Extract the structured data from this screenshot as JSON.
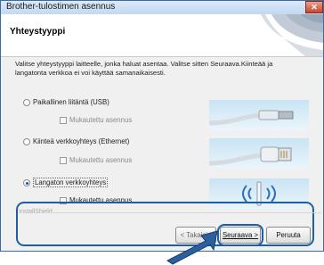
{
  "window": {
    "title": "Brother-tulostimen asennus",
    "close_symbol": "✕"
  },
  "header": {
    "heading": "Yhteystyyppi"
  },
  "description": "Valitse yhteystyyppi laitteelle, jonka haluat asentaa. Valitse sitten Seuraava.Kiinteää ja langatonta verkkoa ei voi käyttää samanaikaisesti.",
  "options": [
    {
      "label": "Paikallinen liitäntä (USB)",
      "selected": false,
      "custom_label": "Mukautettu asennus",
      "custom_enabled": false
    },
    {
      "label": "Kiinteä verkkoyhteys (Ethernet)",
      "selected": false,
      "custom_label": "Mukautettu asennus",
      "custom_enabled": false
    },
    {
      "label": "Langaton verkkoyhteys",
      "selected": true,
      "custom_label": "Mukautettu asennus",
      "custom_enabled": true
    }
  ],
  "footer": {
    "brand": "InstallShield",
    "back_label": "< Takaisin",
    "next_label": "Seuraava >",
    "cancel_label": "Peruuta"
  },
  "colors": {
    "highlight": "#1d5fa3",
    "title_bar": "#c4d8f0",
    "close_button": "#c8452c"
  }
}
